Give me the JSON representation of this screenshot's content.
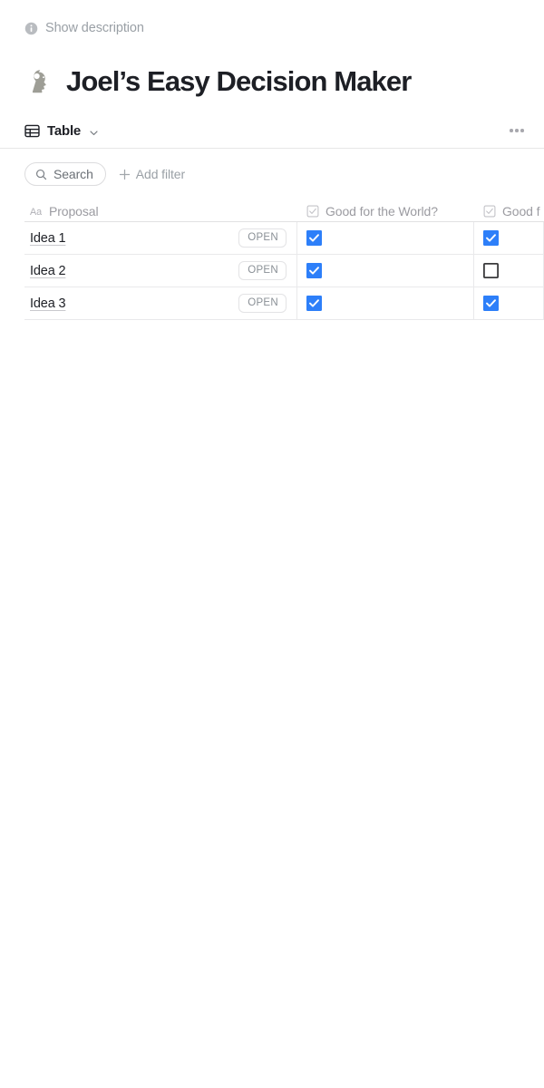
{
  "description_toggle": {
    "icon": "info-circle-icon",
    "label": "Show description"
  },
  "header": {
    "emoji_icon": "head-silhouette-icon",
    "title": "Joel’s Easy Decision Maker"
  },
  "view_bar": {
    "icon": "table-grid-icon",
    "view_name": "Table",
    "chevron_icon": "chevron-down-icon",
    "overflow_icon": "ellipsis-icon"
  },
  "toolbar": {
    "search_icon": "search-icon",
    "search_label": "Search",
    "add_filter_icon": "plus-icon",
    "add_filter_label": "Add filter"
  },
  "grid": {
    "columns": [
      {
        "label": "Proposal",
        "type_icon": "text-field-icon"
      },
      {
        "label": "Good for the World?",
        "type_icon": "checkbox-field-icon"
      },
      {
        "label": "Good f",
        "type_icon": "checkbox-field-icon"
      }
    ],
    "rows": [
      {
        "name": "Idea 1",
        "badge": "OPEN",
        "good_for_world": true,
        "col3": true
      },
      {
        "name": "Idea 2",
        "badge": "OPEN",
        "good_for_world": true,
        "col3": false
      },
      {
        "name": "Idea 3",
        "badge": "OPEN",
        "good_for_world": true,
        "col3": true
      }
    ]
  },
  "colors": {
    "checkbox_checked": "#2D7FF9",
    "checkbox_unchecked_border": "#3a3a3c",
    "text_primary": "#1d1f25",
    "text_muted": "#9aa0a6",
    "divider": "#e6e6e6"
  }
}
